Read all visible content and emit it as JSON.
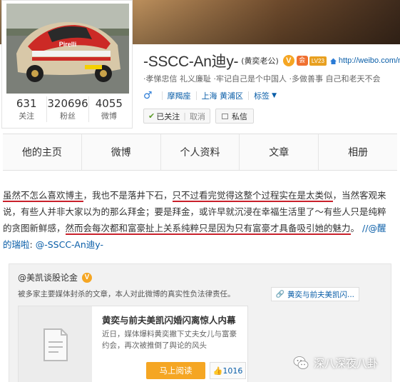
{
  "profile": {
    "name": "-SSCC-An迪y-",
    "remark": "(黄奕老公)",
    "verified_badge": "V",
    "level_badge": "LV23",
    "member_icon": "会",
    "weibo_url": "http://weibo.com/n",
    "intro": "·孝悌忠信 礼义廉耻 ·牢记自己是个中国人 ·多做善事 自己和老天不会",
    "gender_icon": "♂",
    "zodiac": "摩羯座",
    "location": "上海 黄浦区",
    "tags_label": "标签",
    "follow_status": "已关注",
    "follow_cancel": "取消",
    "message_label": "私信",
    "stats": [
      {
        "num": "631",
        "label": "关注"
      },
      {
        "num": "320696",
        "label": "粉丝"
      },
      {
        "num": "4055",
        "label": "微博"
      }
    ]
  },
  "tabs": [
    "他的主页",
    "微博",
    "个人资料",
    "文章",
    "相册"
  ],
  "post": {
    "line1a": "虽然不怎么喜欢博主",
    "line1b": "，我也不是落井下石，",
    "line1c": "只不过看完觉得这整个过程实在是太类似",
    "line1d": "，当然客观来说，有些人并非大家以为的那么拜金；要是拜金，或许早就沉浸在幸福生活里了～有些人只是纯粹的贪图新鲜感，",
    "line1e": "然而会每次都和富豪扯上关系纯粹只是因为只有富豪才具备吸引她的魅力",
    "line1f": "。",
    "repost_prefix": "//",
    "mention1": "@醒的瑞啦",
    "colon": ":",
    "mention2": "@-SSCC-An迪y-"
  },
  "original": {
    "author": "@美凯谈股论金",
    "author_badge": "V",
    "note": "被多家主要媒体封杀的文章，本人对此微博的真实性负法律责任。",
    "topic": "黄奕与前夫美凯闪...",
    "article": {
      "title": "黄奕与前夫美凯闪婚闪离惊人内幕",
      "desc": "近日，媒体爆料黄奕撇下丈夫女儿与富豪约会，再次被推倒了舆论的风头",
      "read_label": "马上阅读",
      "likes": "1016"
    }
  },
  "watermark": "深八深夜八卦",
  "colors": {
    "link": "#0a5ea8",
    "accent": "#f5a623",
    "underline": "#c8202a"
  }
}
